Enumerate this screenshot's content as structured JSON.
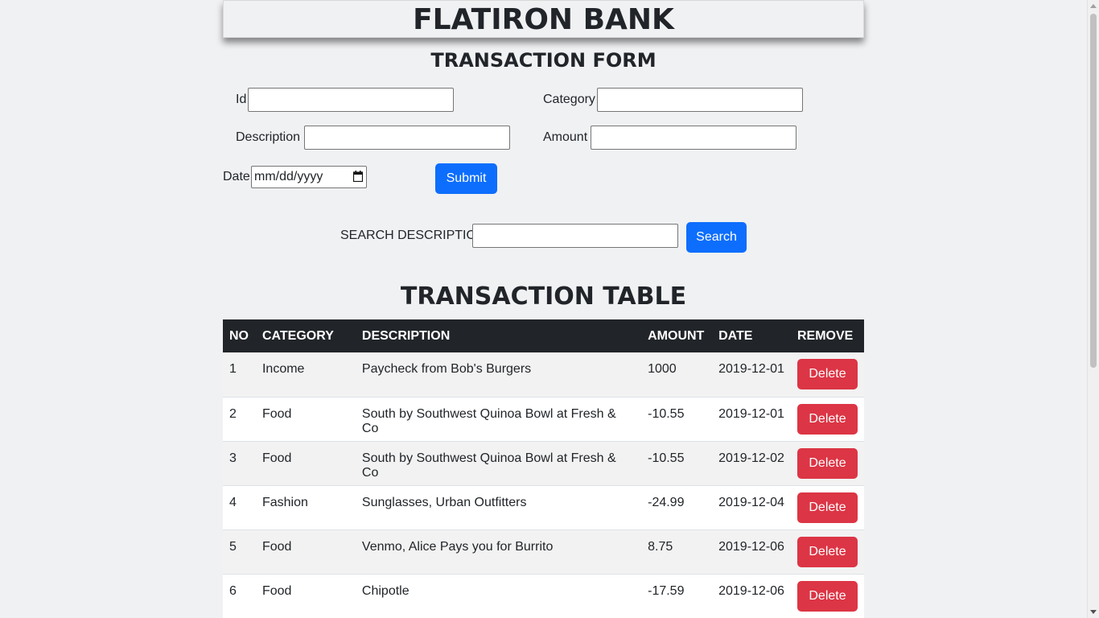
{
  "header": {
    "title": "FLATIRON BANK"
  },
  "form": {
    "title": "TRANSACTION FORM",
    "id_label": "Id",
    "id_value": "",
    "category_label": "Category",
    "category_value": "",
    "description_label": "Description",
    "description_value": "",
    "amount_label": "Amount",
    "amount_value": "",
    "date_label": "Date",
    "date_placeholder": "mm/dd/yyyy",
    "submit_label": "Submit"
  },
  "search": {
    "label": "SEARCH DESCRIPTION",
    "value": "",
    "button_label": "Search"
  },
  "table": {
    "title": "TRANSACTION TABLE",
    "columns": [
      "NO",
      "CATEGORY",
      "DESCRIPTION",
      "AMOUNT",
      "DATE",
      "REMOVE"
    ],
    "rows": [
      {
        "no": "1",
        "category": "Income",
        "description": "Paycheck from Bob's Burgers",
        "amount": "1000",
        "date": "2019-12-01",
        "remove_label": "Delete"
      },
      {
        "no": "2",
        "category": "Food",
        "description": "South by Southwest Quinoa Bowl at Fresh & Co",
        "amount": "-10.55",
        "date": "2019-12-01",
        "remove_label": "Delete"
      },
      {
        "no": "3",
        "category": "Food",
        "description": "South by Southwest Quinoa Bowl at Fresh & Co",
        "amount": "-10.55",
        "date": "2019-12-02",
        "remove_label": "Delete"
      },
      {
        "no": "4",
        "category": "Fashion",
        "description": "Sunglasses, Urban Outfitters",
        "amount": "-24.99",
        "date": "2019-12-04",
        "remove_label": "Delete"
      },
      {
        "no": "5",
        "category": "Food",
        "description": "Venmo, Alice Pays you for Burrito",
        "amount": "8.75",
        "date": "2019-12-06",
        "remove_label": "Delete"
      },
      {
        "no": "6",
        "category": "Food",
        "description": "Chipotle",
        "amount": "-17.59",
        "date": "2019-12-06",
        "remove_label": "Delete"
      }
    ]
  },
  "colors": {
    "primary_button": "#0d6efd",
    "danger_button": "#dc3545",
    "table_header": "#212529",
    "page_background": "#f0f1f3"
  },
  "icons": {
    "date_picker": "calendar-icon"
  }
}
